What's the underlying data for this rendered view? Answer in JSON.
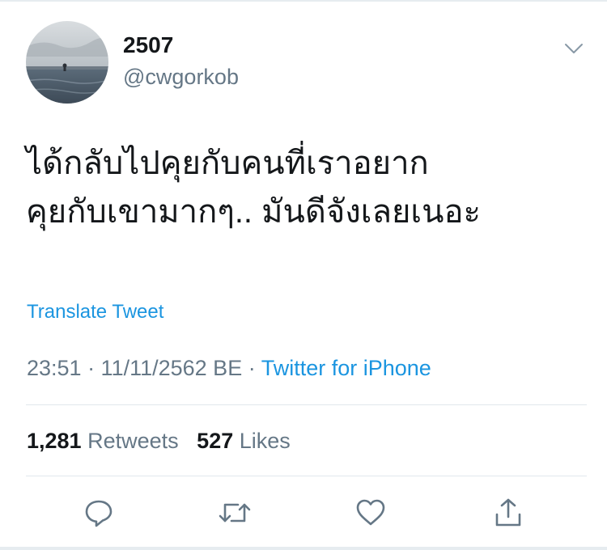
{
  "user": {
    "display_name": "2507",
    "handle": "@cwgorkob",
    "avatar_icon": "profile-photo-pool-horizon"
  },
  "tweet": {
    "lines": [
      "ได้กลับไปคุยกับคนที่เราอยาก",
      "คุยกับเขามากๆ.. มันดีจังเลยเนอะ"
    ],
    "translate_label": "Translate Tweet",
    "timestamp": "23:51 · 11/11/2562 BE",
    "separator": " · ",
    "source": "Twitter for iPhone"
  },
  "stats": {
    "retweets_count": "1,281",
    "retweets_label": "Retweets",
    "likes_count": "527",
    "likes_label": "Likes"
  },
  "actions": [
    "reply-icon",
    "retweet-icon",
    "like-icon",
    "share-icon"
  ],
  "colors": {
    "link": "#1b95e0",
    "secondary_text": "#657786",
    "primary_text": "#14171a",
    "divider": "#e1e8ed"
  }
}
